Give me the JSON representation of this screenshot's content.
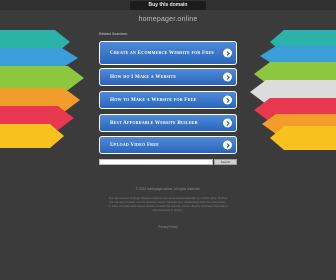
{
  "topbar": {
    "buy_label": "Buy this domain"
  },
  "domain": "homepager.online",
  "related_label": "Related Searches:",
  "links": [
    {
      "label": "Create an Ecommerce Website for Free"
    },
    {
      "label": "How do I Make a Website"
    },
    {
      "label": "How to Make a Website for Free"
    },
    {
      "label": "Best Affordable Website Builder"
    },
    {
      "label": "Upload Video Free"
    }
  ],
  "search": {
    "placeholder": "",
    "button_label": "Search"
  },
  "footer": {
    "copyright": "© 2024 homepager.online. All rights reserved.",
    "disclaimer": "The Sponsored Listings displayed above are served automatically by a third party. Neither the service provider nor the domain owner maintain any relationship with the advertisers. In case of trademark issues please contact the domain owner directly (contact information can be found in whois).",
    "privacy": "Privacy Policy"
  },
  "colors": {
    "background": "#3b3b3b",
    "button_top": "#4f8ad9",
    "button_bottom": "#2a65b8",
    "ribbon_left": [
      "#2bb3a7",
      "#3c9ed9",
      "#8dc63f",
      "#f29c2b",
      "#e8384f",
      "#f7c21d"
    ],
    "ribbon_right": [
      "#2bb3a7",
      "#3c9ed9",
      "#8dc63f",
      "#dcdcdc",
      "#e8384f",
      "#f29c2b",
      "#f7c21d"
    ]
  }
}
